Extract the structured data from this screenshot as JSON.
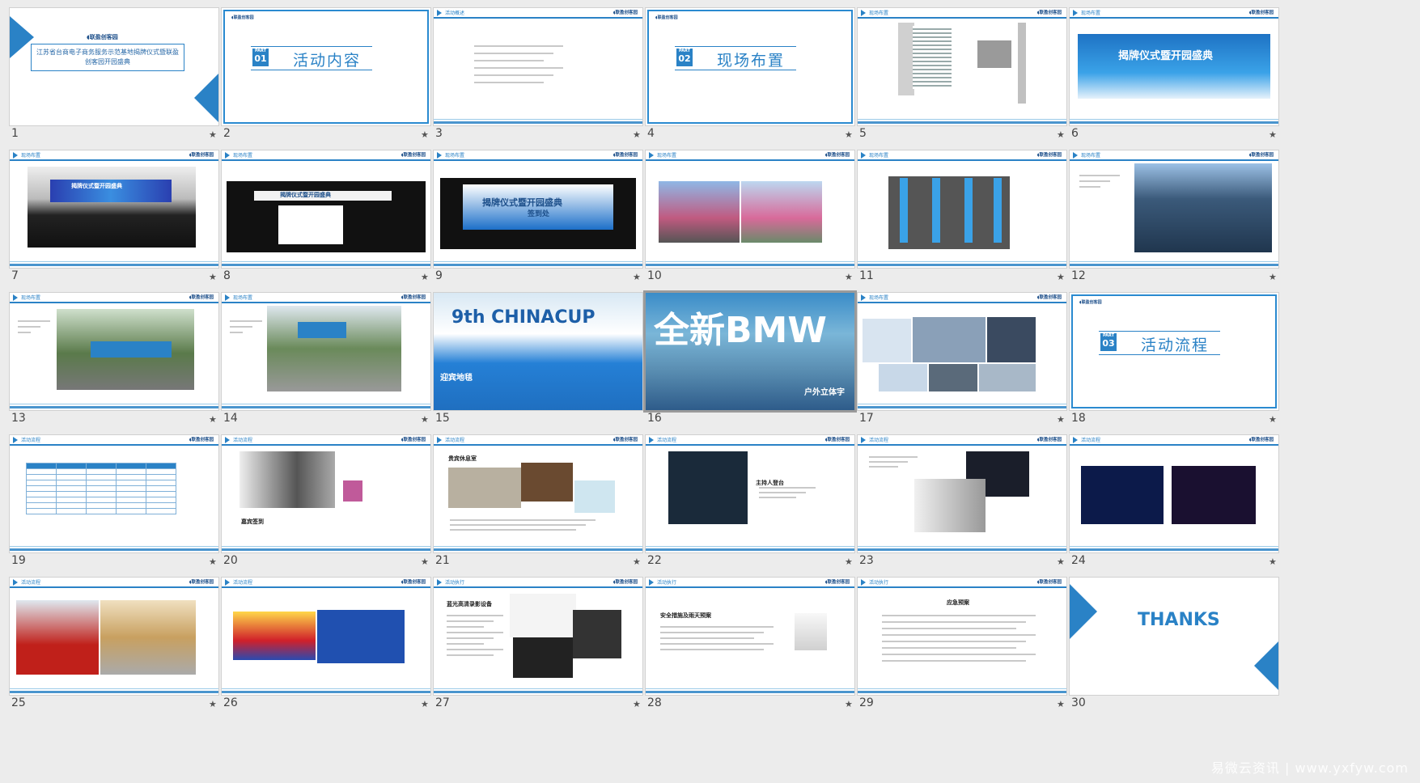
{
  "slides": [
    {
      "num": "1",
      "title": "",
      "text": "江苏省台商电子商务服务示范基地揭牌仪式暨联盈创客园开园盛典",
      "logo": "联盈创客园"
    },
    {
      "num": "2",
      "part": "01",
      "section": "活动内容",
      "logo": "联盈创客园"
    },
    {
      "num": "3",
      "title": "活动概述",
      "logo": "联盈创客园"
    },
    {
      "num": "4",
      "part": "02",
      "section": "现场布置",
      "logo": "联盈创客园"
    },
    {
      "num": "5",
      "title": "现场布置",
      "logo": "联盈创客园"
    },
    {
      "num": "6",
      "title": "现场布置",
      "logo": "联盈创客园",
      "banner": "揭牌仪式暨开园盛典"
    },
    {
      "num": "7",
      "title": "现场布置",
      "logo": "联盈创客园",
      "banner": "揭牌仪式暨开园盛典"
    },
    {
      "num": "8",
      "title": "现场布置",
      "logo": "联盈创客园",
      "banner": "揭牌仪式暨开园盛典"
    },
    {
      "num": "9",
      "title": "现场布置",
      "logo": "联盈创客园",
      "banner": "揭牌仪式暨开园盛典",
      "sub": "签到处"
    },
    {
      "num": "10",
      "title": "现场布置",
      "logo": "联盈创客园"
    },
    {
      "num": "11",
      "title": "现场布置",
      "logo": "联盈创客园"
    },
    {
      "num": "12",
      "title": "现场布置",
      "logo": "联盈创客园"
    },
    {
      "num": "13",
      "title": "现场布置",
      "logo": "联盈创客园"
    },
    {
      "num": "14",
      "title": "现场布置",
      "logo": "联盈创客园"
    },
    {
      "num": "15",
      "photo_caption": "迎宾地毯",
      "photo_big": "9th CHINACUP"
    },
    {
      "num": "16",
      "photo_caption": "户外立体字",
      "photo_big": "全新BMW"
    },
    {
      "num": "17",
      "title": "现场布置",
      "logo": "联盈创客园"
    },
    {
      "num": "18",
      "part": "03",
      "section": "活动流程",
      "logo": "联盈创客园"
    },
    {
      "num": "19",
      "title": "活动流程",
      "logo": "联盈创客园"
    },
    {
      "num": "20",
      "title": "活动流程",
      "logo": "联盈创客园",
      "caption": "嘉宾签到"
    },
    {
      "num": "21",
      "title": "活动流程",
      "logo": "联盈创客园",
      "caption": "贵宾休息室"
    },
    {
      "num": "22",
      "title": "活动流程",
      "logo": "联盈创客园",
      "caption": "主持人登台"
    },
    {
      "num": "23",
      "title": "活动流程",
      "logo": "联盈创客园"
    },
    {
      "num": "24",
      "title": "活动流程",
      "logo": "联盈创客园"
    },
    {
      "num": "25",
      "title": "活动流程",
      "logo": "联盈创客园"
    },
    {
      "num": "26",
      "title": "活动流程",
      "logo": "联盈创客园"
    },
    {
      "num": "27",
      "title": "活动执行",
      "logo": "联盈创客园",
      "caption": "蓝光高清录影设备"
    },
    {
      "num": "28",
      "title": "活动执行",
      "logo": "联盈创客园",
      "caption": "安全措施及雨天预案"
    },
    {
      "num": "29",
      "title": "活动执行",
      "logo": "联盈创客园",
      "caption": "应急预案"
    },
    {
      "num": "30",
      "thanks": "THANKS"
    }
  ],
  "star": "★",
  "watermark": "易微云资讯 | www.yxfyw.com",
  "colors": {
    "accent": "#2a82c6",
    "selected": "#9a9a9a",
    "background": "#ececec"
  }
}
